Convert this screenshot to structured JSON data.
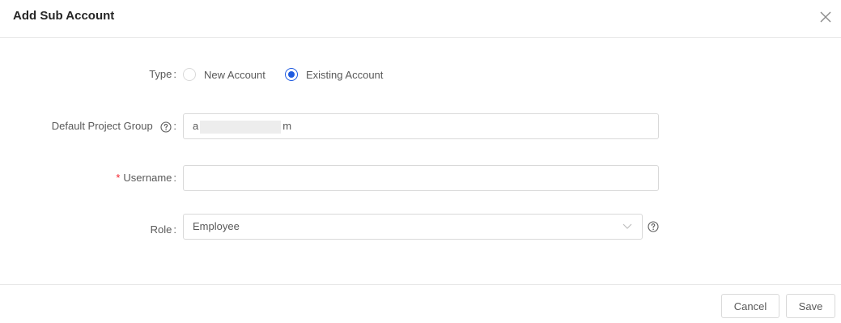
{
  "modal": {
    "title": "Add Sub Account"
  },
  "form": {
    "type": {
      "label": "Type",
      "options": [
        "New Account",
        "Existing Account"
      ],
      "selected": "Existing Account"
    },
    "default_project_group": {
      "label": "Default Project Group",
      "value_start": "a",
      "value_end": "m"
    },
    "username": {
      "label": "Username",
      "required_marker": "*",
      "value": ""
    },
    "role": {
      "label": "Role",
      "value": "Employee"
    },
    "colon": ":"
  },
  "footer": {
    "cancel_label": "Cancel",
    "save_label": "Save"
  },
  "colors": {
    "accent": "#1f5be0",
    "required": "#f5222d",
    "border": "#d9d9d9"
  },
  "icons": {
    "close": "close-icon",
    "help": "question-circle-icon",
    "dropdown": "chevron-down-icon"
  }
}
